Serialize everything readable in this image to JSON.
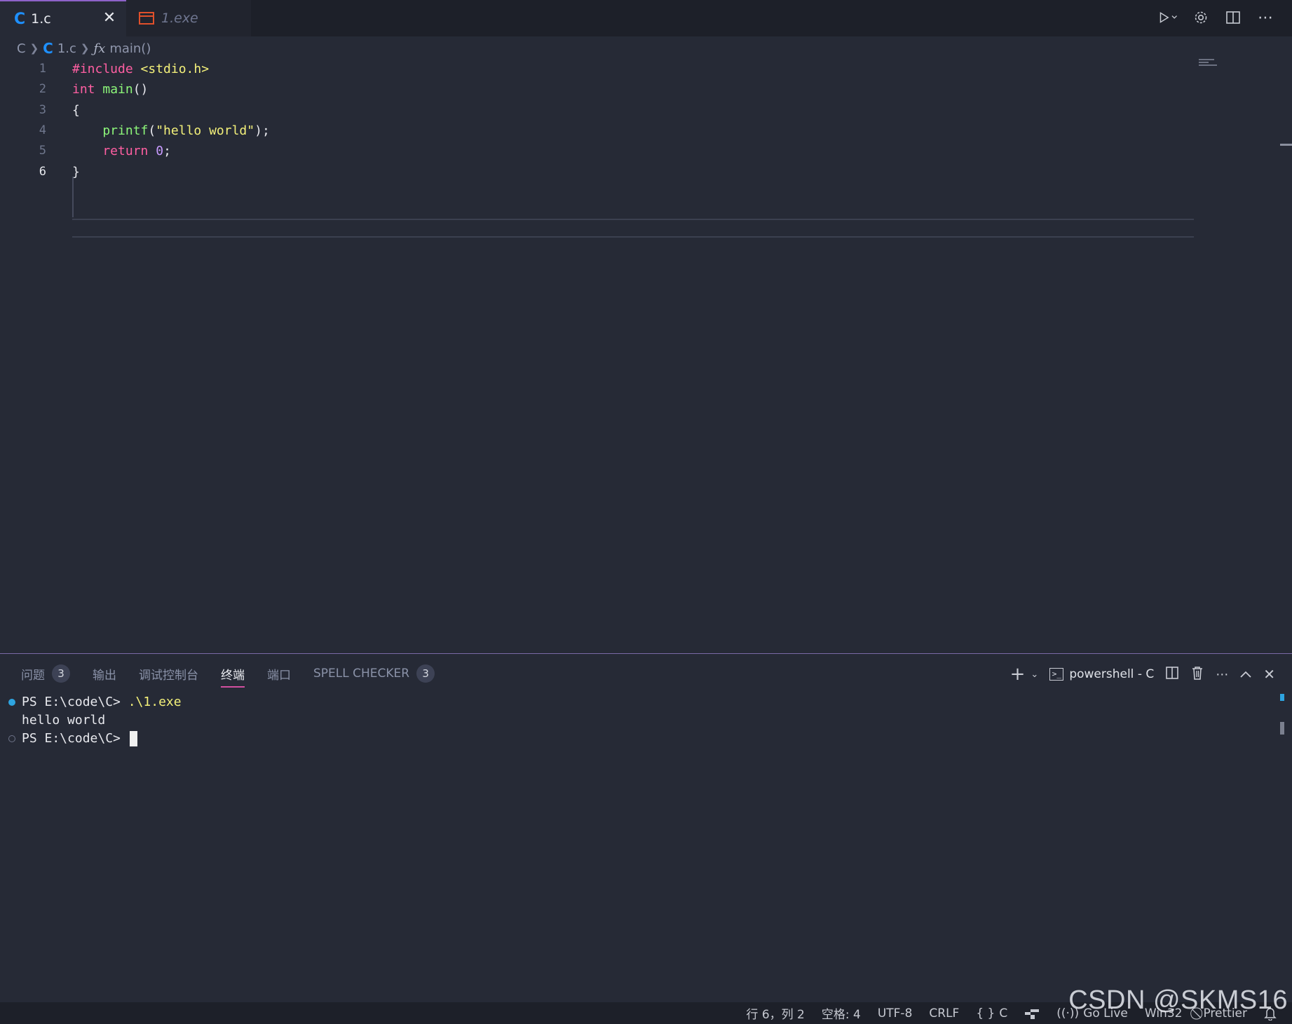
{
  "tabs": [
    {
      "label": "1.c",
      "active": true,
      "icon": "c-language-icon"
    },
    {
      "label": "1.exe",
      "active": false,
      "icon": "binary-file-icon"
    }
  ],
  "breadcrumb": {
    "folder": "C",
    "file": "1.c",
    "symbol": "main()"
  },
  "editor": {
    "lines": [
      {
        "num": "1",
        "segments": [
          {
            "t": "#include <stdio.h>",
            "c": "kw-pink-yellow"
          }
        ]
      },
      {
        "num": "2",
        "segments": [
          {
            "t": "int",
            "c": "kw-pink"
          },
          {
            "t": " main",
            "c": "kw-green"
          },
          {
            "t": "()",
            "c": "plain"
          }
        ]
      },
      {
        "num": "3",
        "segments": [
          {
            "t": "{",
            "c": "plain"
          }
        ]
      },
      {
        "num": "4",
        "segments": [
          {
            "t": "    printf",
            "c": "kw-green"
          },
          {
            "t": "(",
            "c": "plain"
          },
          {
            "t": "\"hello world\"",
            "c": "str-yellow"
          },
          {
            "t": ");",
            "c": "plain"
          }
        ]
      },
      {
        "num": "5",
        "segments": [
          {
            "t": "    return ",
            "c": "kw-pink"
          },
          {
            "t": "0",
            "c": "num-purple"
          },
          {
            "t": ";",
            "c": "plain"
          }
        ]
      },
      {
        "num": "6",
        "segments": [
          {
            "t": "}",
            "c": "plain"
          }
        ]
      }
    ],
    "current_line": "6"
  },
  "panel": {
    "tabs": [
      {
        "label": "问题",
        "badge": "3"
      },
      {
        "label": "输出"
      },
      {
        "label": "调试控制台"
      },
      {
        "label": "终端",
        "active": true
      },
      {
        "label": "端口"
      },
      {
        "label": "SPELL CHECKER",
        "badge": "3"
      }
    ],
    "terminal_name": "powershell - C"
  },
  "terminal": {
    "lines": [
      {
        "prompt": "PS E:\\code\\C> ",
        "command": ".\\1.exe",
        "dot": "filled"
      },
      {
        "text": "hello world"
      },
      {
        "prompt": "PS E:\\code\\C> ",
        "dot": "hollow",
        "cursor": true
      }
    ]
  },
  "statusbar": {
    "position": "行 6，列 2",
    "spaces": "空格: 4",
    "encoding": "UTF-8",
    "eol": "CRLF",
    "language": "C",
    "go_live": "Go Live",
    "platform": "Win32",
    "prettier": "Prettier"
  },
  "watermark": "CSDN @SKMS16",
  "colors": {
    "accent_tab": "#8e62c9",
    "terminal_active": "#d24fa0",
    "c_icon": "#1e90ff",
    "exe_icon": "#e0502b"
  }
}
